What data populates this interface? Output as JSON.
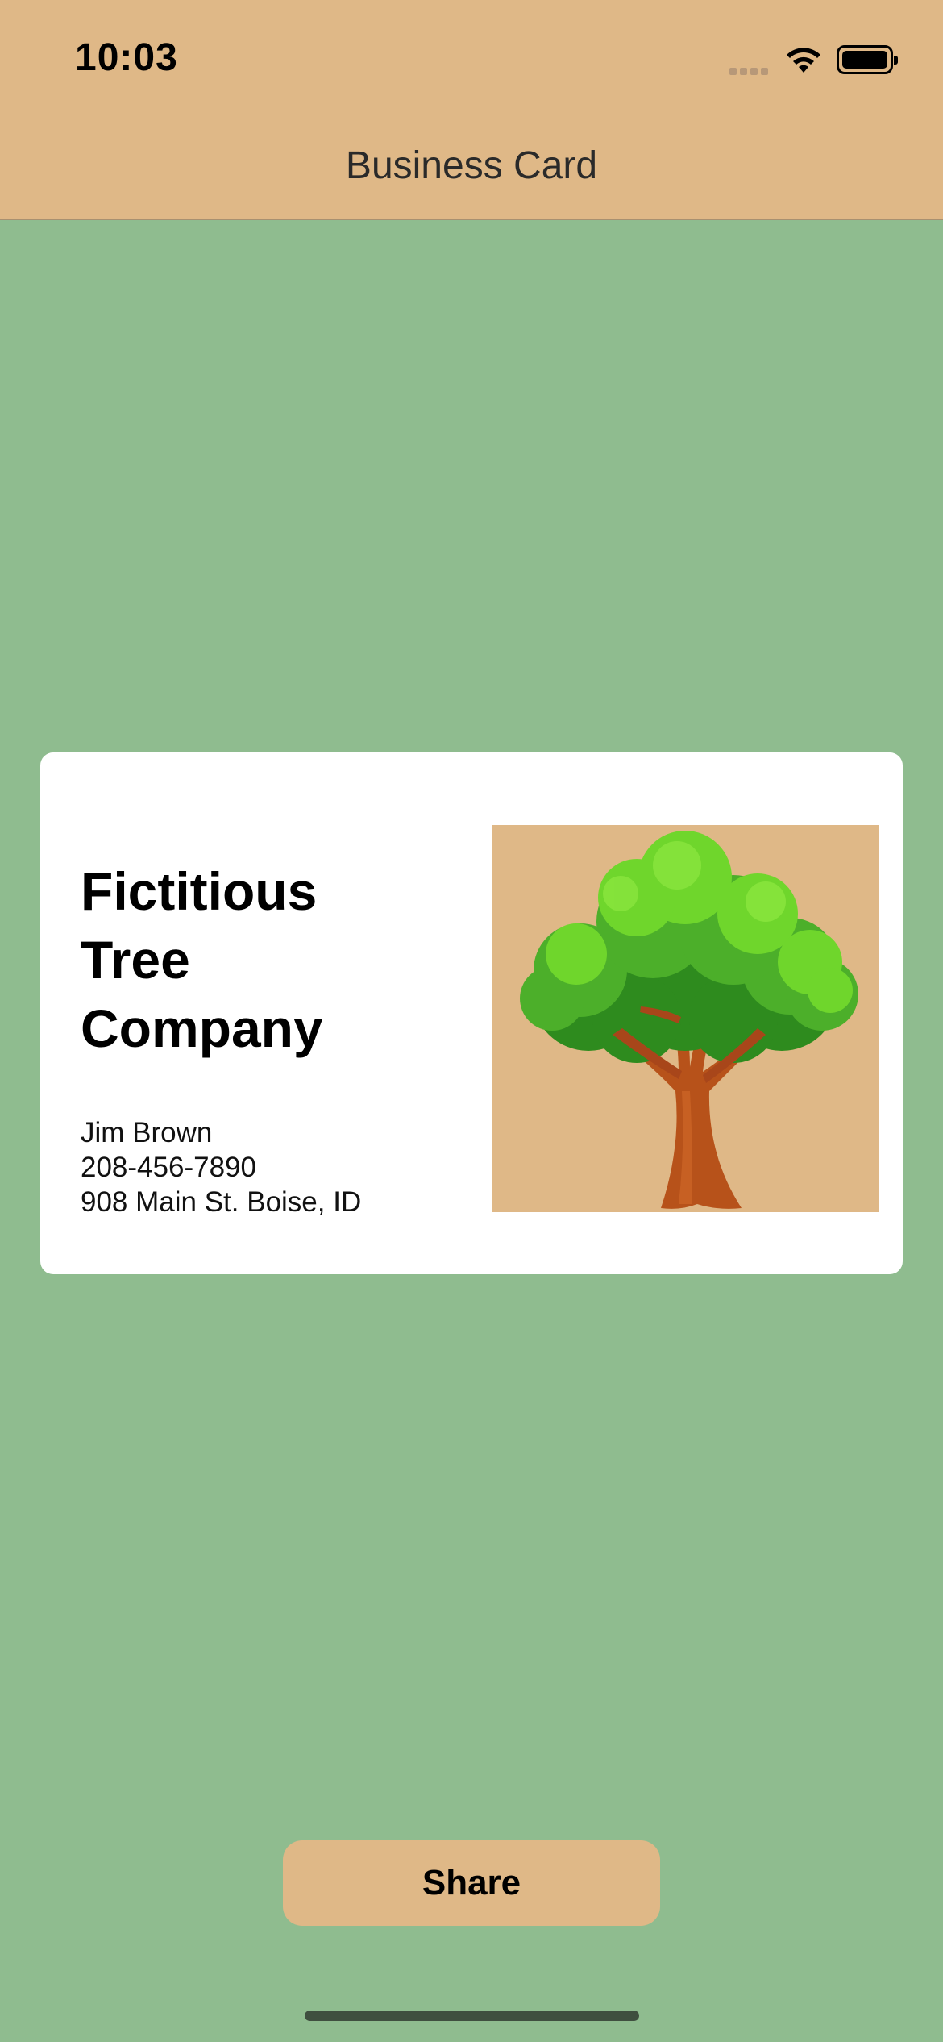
{
  "status_bar": {
    "time": "10:03"
  },
  "nav": {
    "title": "Business Card"
  },
  "card": {
    "company_lines": [
      "Fictitious",
      "Tree",
      "Company"
    ],
    "name": "Jim Brown",
    "phone": "208-456-7890",
    "address": "908 Main St. Boise, ID"
  },
  "actions": {
    "share_label": "Share"
  },
  "colors": {
    "accent": "#DFB887",
    "background": "#8FBC8F",
    "card": "#FFFFFF"
  }
}
